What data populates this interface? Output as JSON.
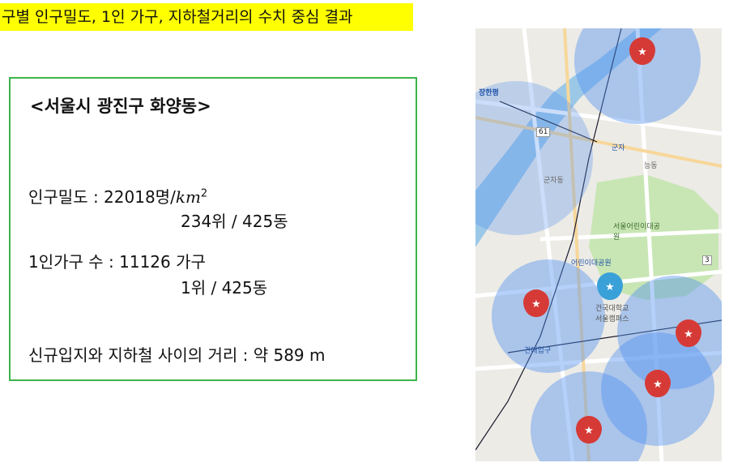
{
  "headline": "구별 인구밀도, 1인 가구, 지하철거리의 수치 중심 결과",
  "district": "<서울시 광진구 화양동>",
  "density": {
    "label": "인구밀도 : 22018명/",
    "unit": "km",
    "unit_power": "2",
    "rank": "234위 / 425동"
  },
  "single_household": {
    "label": "1인가구 수 : 11126 가구",
    "rank": "1위 / 425동"
  },
  "subway_distance": {
    "label": "신규입지와 지하철 사이의 거리 : 약 589 m"
  },
  "map": {
    "labels": {
      "station_jangan": "장한평",
      "gunja_dong": "군자동",
      "gunja": "군자",
      "neung_dong": "능동",
      "childrens_grand_park": "서울어린이대공원",
      "childrens_park_station": "어린이대공원",
      "konkuk_univ": "건국대학교 서울캠퍼스",
      "konkuk_station": "건대입구",
      "route_61": "61",
      "route_3": "3"
    },
    "colors": {
      "catchment": "#4f8ff0",
      "marker_red": "#d63a36",
      "marker_blue": "#3aa0d8",
      "park": "#c8e6b4",
      "river": "#9cc8e8"
    }
  }
}
